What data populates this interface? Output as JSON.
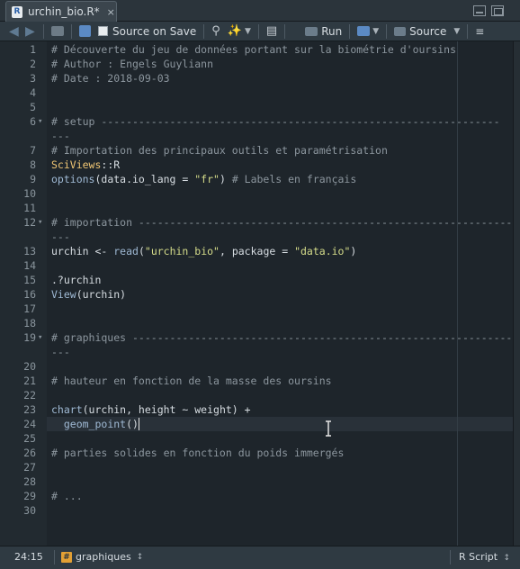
{
  "tab": {
    "title": "urchin_bio.R*",
    "icon": "R-file-icon",
    "close": "×"
  },
  "toolbar": {
    "source_on_save": "Source on Save",
    "run": "Run",
    "source": "Source"
  },
  "editor": {
    "lines": [
      {
        "n": "1",
        "text": "# Découverte du jeu de données portant sur la biométrie d'oursins"
      },
      {
        "n": "2",
        "text": "# Author : Engels Guyliann"
      },
      {
        "n": "3",
        "text": "# Date : 2018-09-03"
      },
      {
        "n": "4",
        "text": ""
      },
      {
        "n": "5",
        "text": ""
      },
      {
        "n": "6",
        "text": "# setup ----------------------------------------------------------------"
      },
      {
        "n": "",
        "text": "---"
      },
      {
        "n": "7",
        "text": "# Importation des principaux outils et paramétrisation"
      },
      {
        "n": "8",
        "text": "SciViews::R"
      },
      {
        "n": "9",
        "text": "options(data.io_lang = \"fr\") # Labels en français"
      },
      {
        "n": "10",
        "text": ""
      },
      {
        "n": "11",
        "text": ""
      },
      {
        "n": "12",
        "text": "# importation ------------------------------------------------------------"
      },
      {
        "n": "",
        "text": "---"
      },
      {
        "n": "13",
        "text": "urchin <- read(\"urchin_bio\", package = \"data.io\")"
      },
      {
        "n": "14",
        "text": ""
      },
      {
        "n": "15",
        "text": ".?urchin"
      },
      {
        "n": "16",
        "text": "View(urchin)"
      },
      {
        "n": "17",
        "text": ""
      },
      {
        "n": "18",
        "text": ""
      },
      {
        "n": "19",
        "text": "# graphiques -------------------------------------------------------------"
      },
      {
        "n": "",
        "text": "---"
      },
      {
        "n": "20",
        "text": ""
      },
      {
        "n": "21",
        "text": "# hauteur en fonction de la masse des oursins"
      },
      {
        "n": "22",
        "text": ""
      },
      {
        "n": "23",
        "text": "chart(urchin, height ~ weight) +"
      },
      {
        "n": "24",
        "text": "  geom_point()"
      },
      {
        "n": "25",
        "text": ""
      },
      {
        "n": "26",
        "text": "# parties solides en fonction du poids immergés"
      },
      {
        "n": "27",
        "text": ""
      },
      {
        "n": "28",
        "text": ""
      },
      {
        "n": "29",
        "text": "# ..."
      },
      {
        "n": "30",
        "text": ""
      }
    ]
  },
  "status": {
    "position": "24:15",
    "section": "graphiques",
    "filetype": "R Script"
  },
  "colors": {
    "background": "#1e252b",
    "comment": "#8c969e",
    "string": "#d5dc8a",
    "function": "#9fb9d4",
    "namespace": "#f0c674"
  }
}
